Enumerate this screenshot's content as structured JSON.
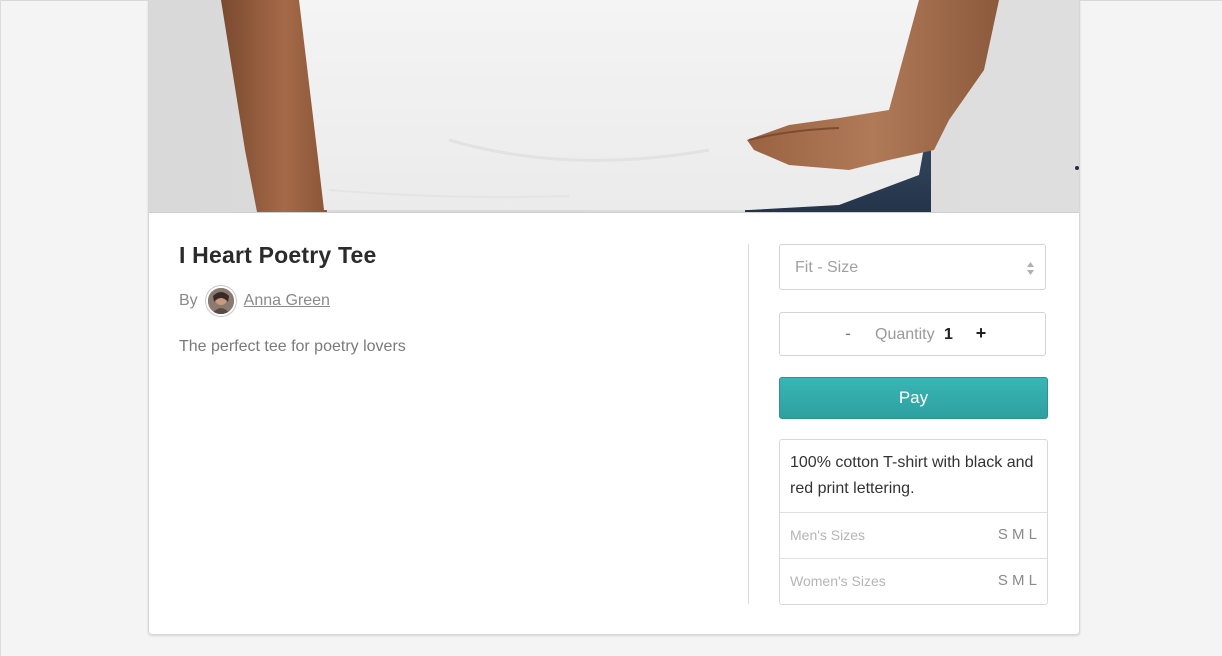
{
  "product": {
    "title": "I Heart Poetry Tee",
    "by_label": "By",
    "author_name": "Anna Green",
    "description": "The perfect tee for poetry lovers"
  },
  "purchase": {
    "fit_size_placeholder": "Fit - Size",
    "quantity_minus": "-",
    "quantity_label": "Quantity",
    "quantity_value": "1",
    "quantity_plus": "+",
    "pay_label": "Pay"
  },
  "details": {
    "text": "100% cotton T-shirt with black and red print lettering.",
    "sizes": [
      {
        "label": "Men's Sizes",
        "values": "S M L"
      },
      {
        "label": "Women's Sizes",
        "values": "S M L"
      }
    ]
  },
  "colors": {
    "pay_button": "#33abab",
    "page_background": "#f4f4f4"
  }
}
